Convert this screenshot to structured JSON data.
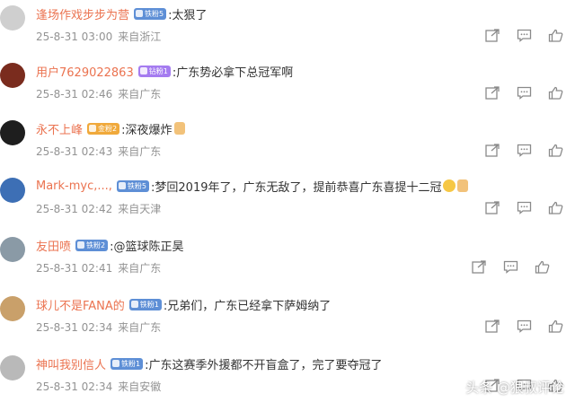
{
  "comments": [
    {
      "user": "逢场作戏步步为营",
      "badge": "铁粉5",
      "badge_color": "#5e8fd6",
      "text": ":太狠了",
      "emoji": "",
      "time": "25-8-31 03:00",
      "location": "来自浙江"
    },
    {
      "user": "用户7629022863",
      "badge": "钻粉1",
      "badge_color": "#a57cf0",
      "text": ":广东势必拿下总冠军啊",
      "emoji": "",
      "time": "25-8-31 02:46",
      "location": "来自广东"
    },
    {
      "user": "永不上峰",
      "badge": "金粉2",
      "badge_color": "#f0a93b",
      "text": ":深夜爆炸",
      "emoji": "thumbs-up",
      "time": "25-8-31 02:43",
      "location": "来自广东"
    },
    {
      "user": "Mark-myc,...,",
      "badge": "铁粉5",
      "badge_color": "#5e8fd6",
      "text": ":梦回2019年了，广东无敌了，提前恭喜广东喜提十二冠",
      "emoji": "smile+thumbs-up",
      "time": "25-8-31 02:42",
      "location": "来自天津"
    },
    {
      "user": "友田喷",
      "badge": "铁粉2",
      "badge_color": "#5e8fd6",
      "text": ":@篮球陈正昊",
      "emoji": "",
      "time": "25-8-31 02:41",
      "location": "来自广东"
    },
    {
      "user": "球儿不是FANA的",
      "badge": "铁粉1",
      "badge_color": "#5e8fd6",
      "text": ":兄弟们，广东已经拿下萨姆纳了",
      "emoji": "",
      "time": "25-8-31 02:34",
      "location": "来自广东"
    },
    {
      "user": "神叫我别信人",
      "badge": "铁粉1",
      "badge_color": "#5e8fd6",
      "text": ":广东这赛季外援都不开盲盒了，完了要夺冠了",
      "emoji": "",
      "time": "25-8-31 02:34",
      "location": "来自安徽"
    }
  ],
  "icons": [
    "share-icon",
    "comment-icon",
    "like-icon"
  ],
  "watermark": "头条 @狠叔评论",
  "colors": {
    "username": "#eb7350",
    "meta": "#939393",
    "text": "#333333",
    "icon": "#8a8a8a"
  }
}
